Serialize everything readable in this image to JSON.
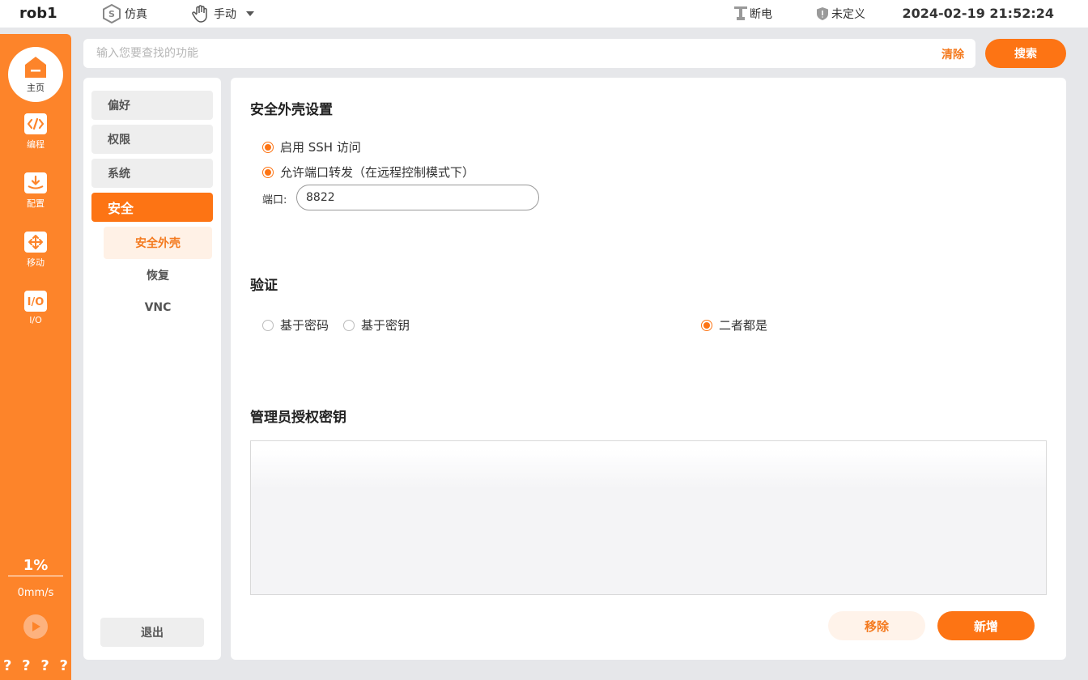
{
  "topbar": {
    "robot_name": "rob1",
    "sim_label": "仿真",
    "mode_label": "手动",
    "power_label": "断电",
    "safety_label": "未定义",
    "datetime": "2024-02-19 21:52:24"
  },
  "rail": {
    "home_label": "主页",
    "items": [
      {
        "label": "编程",
        "icon": "code-icon"
      },
      {
        "label": "配置",
        "icon": "download-icon"
      },
      {
        "label": "移动",
        "icon": "move-icon"
      },
      {
        "label": "I/O",
        "icon": "io-icon"
      }
    ],
    "speed_percent": "1%",
    "speed_value": "0mm/s",
    "qmarks": [
      "?",
      "?",
      "?",
      "?"
    ]
  },
  "search": {
    "placeholder": "输入您要查找的功能",
    "value": "",
    "clear_label": "清除",
    "button_label": "搜索"
  },
  "nav": {
    "items": [
      {
        "label": "偏好"
      },
      {
        "label": "权限"
      },
      {
        "label": "系统"
      },
      {
        "label": "安全",
        "active": true
      }
    ],
    "sub_items": [
      {
        "label": "安全外壳",
        "active": true
      },
      {
        "label": "恢复"
      },
      {
        "label": "VNC"
      }
    ],
    "exit_label": "退出"
  },
  "content": {
    "ssh_section_title": "安全外壳设置",
    "enable_ssh_label": "启用 SSH 访问",
    "enable_ssh_checked": true,
    "port_forward_label": "允许端口转发（在远程控制模式下）",
    "port_forward_checked": true,
    "port_label": "端口:",
    "port_value": "8822",
    "auth_section_title": "验证",
    "auth_options": [
      {
        "label": "基于密码",
        "selected": false
      },
      {
        "label": "基于密钥",
        "selected": false
      },
      {
        "label": "二者都是",
        "selected": true
      }
    ],
    "keys_section_title": "管理员授权密钥",
    "remove_label": "移除",
    "add_label": "新增"
  },
  "colors": {
    "accent": "#fd7414",
    "rail": "#fd842a",
    "background": "#e6e7ea"
  }
}
